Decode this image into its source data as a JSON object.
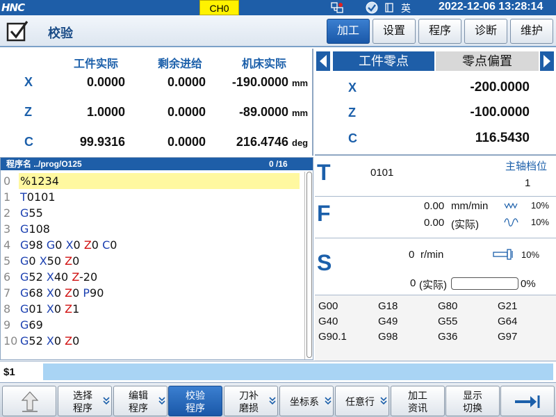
{
  "status": {
    "logo": "HNC",
    "channel": "CH0",
    "ime": "英",
    "datetime": "2022-12-06 13:28:14"
  },
  "title": {
    "mode": "校验",
    "tabs": [
      "加工",
      "设置",
      "程序",
      "诊断",
      "维护"
    ],
    "active_tab": "加工"
  },
  "coords": {
    "headers": [
      "工件实际",
      "剩余进给",
      "机床实际"
    ],
    "rows": [
      {
        "axis": "X",
        "work": "0.0000",
        "remain": "0.0000",
        "machine": "-190.0000",
        "unit": "mm"
      },
      {
        "axis": "Z",
        "work": "1.0000",
        "remain": "0.0000",
        "machine": "-89.0000",
        "unit": "mm"
      },
      {
        "axis": "C",
        "work": "99.9316",
        "remain": "0.0000",
        "machine": "216.4746",
        "unit": "deg"
      }
    ]
  },
  "zero_point": {
    "tab_active": "工件零点",
    "tab_other": "零点偏置",
    "rows": [
      {
        "axis": "X",
        "value": "-200.0000"
      },
      {
        "axis": "Z",
        "value": "-100.0000"
      },
      {
        "axis": "C",
        "value": "116.5430"
      }
    ]
  },
  "program": {
    "name": "程序名 ../prog/O125",
    "position": "0 /16",
    "lines": [
      {
        "n": "0",
        "text": "%1234"
      },
      {
        "n": "1",
        "text": "T0101"
      },
      {
        "n": "2",
        "text": "G55"
      },
      {
        "n": "3",
        "text": "G108"
      },
      {
        "n": "4",
        "text": "G98 G0 X0 Z0 C0"
      },
      {
        "n": "5",
        "text": "G0 X50 Z0"
      },
      {
        "n": "6",
        "text": "G52 X40 Z-20"
      },
      {
        "n": "7",
        "text": "G68 X0 Z0 P90"
      },
      {
        "n": "8",
        "text": "G01 X0 Z1"
      },
      {
        "n": "9",
        "text": "G69"
      },
      {
        "n": "10",
        "text": "G52 X0 Z0"
      }
    ]
  },
  "info": {
    "t_label": "T",
    "t_value": "0101",
    "gear_label": "主轴档位",
    "gear_value": "1",
    "f_label": "F",
    "f_rate": "0.00",
    "f_unit": "mm/min",
    "f_override": "10%",
    "f_actual": "0.00",
    "f_actual_label": "(实际)",
    "f_override2": "10%",
    "s_label": "S",
    "s_speed": "0",
    "s_unit": "r/min",
    "s_override": "10%",
    "s_actual": "0",
    "s_actual_label": "(实际)",
    "s_load": "0%",
    "s_load_value": 0
  },
  "gcodes": [
    "G00",
    "G18",
    "G80",
    "G21",
    "G40",
    "G49",
    "G55",
    "G64",
    "G90.1",
    "G98",
    "G36",
    "G97"
  ],
  "cmdline": {
    "prompt": "$1",
    "value": ""
  },
  "fkeys": [
    {
      "id": "up",
      "label": ""
    },
    {
      "id": "select",
      "label": "选择\n程序"
    },
    {
      "id": "edit",
      "label": "编辑\n程序"
    },
    {
      "id": "verify",
      "label": "校验\n程序"
    },
    {
      "id": "tool",
      "label": "刀补\n磨损"
    },
    {
      "id": "coord",
      "label": "坐标系"
    },
    {
      "id": "anyline",
      "label": "任意行"
    },
    {
      "id": "process",
      "label": "加工\n资讯"
    },
    {
      "id": "display",
      "label": "显示\n切换"
    },
    {
      "id": "next",
      "label": ""
    }
  ],
  "colors": {
    "brand_blue": "#1e5ea8",
    "highlight_yellow": "#fff8a0",
    "axis_blue": "#1b5faa",
    "z_red": "#d01010",
    "cmd_bg": "#a9d4f4"
  }
}
